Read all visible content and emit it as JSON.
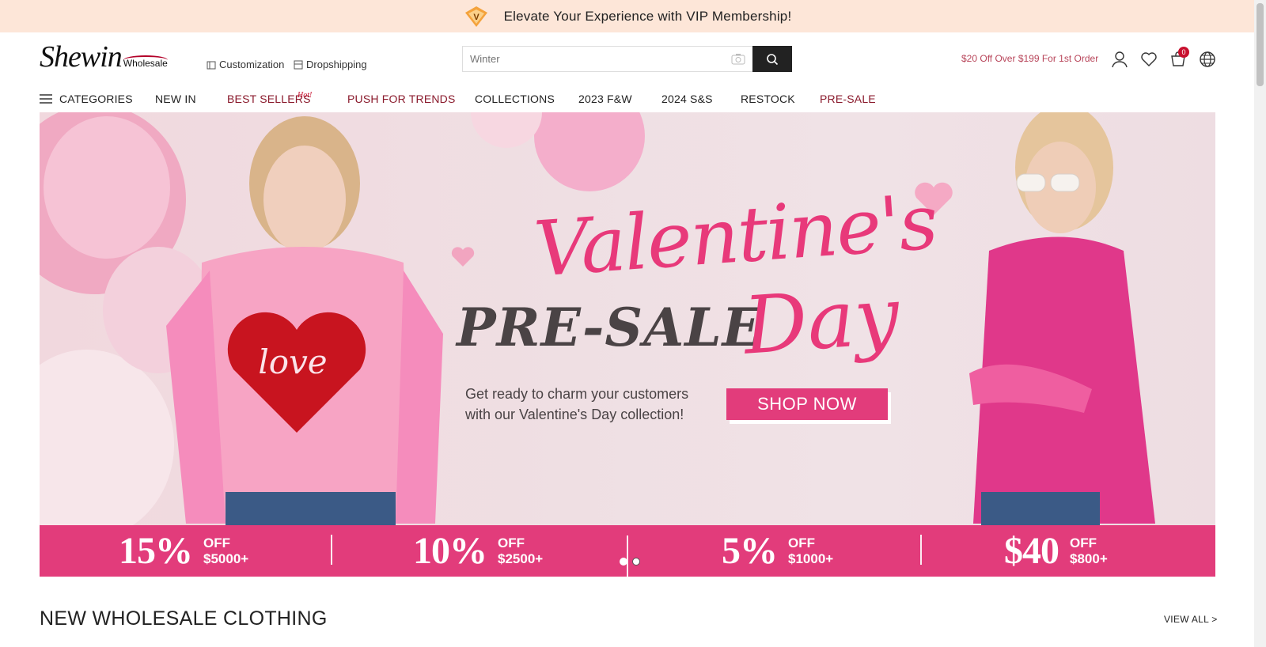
{
  "promo_bar": {
    "text": "Elevate Your Experience with VIP Membership!",
    "icon": "vip-diamond-icon"
  },
  "header": {
    "logo_main": "Shewin",
    "logo_sub": "Wholesale",
    "links": [
      {
        "label": "Customization",
        "icon": "customization-icon"
      },
      {
        "label": "Dropshipping",
        "icon": "dropshipping-icon"
      }
    ],
    "search": {
      "placeholder": "Winter"
    },
    "offer": "$20 Off Over $199 For 1st Order",
    "cart_count": "0"
  },
  "nav": {
    "categories_label": "CATEGORIES",
    "items": [
      {
        "label": "NEW IN"
      },
      {
        "label": "BEST SELLERS",
        "tag": "Hot!"
      },
      {
        "label": "PUSH FOR TRENDS"
      },
      {
        "label": "COLLECTIONS"
      },
      {
        "label": "2023 F&W"
      },
      {
        "label": "2024 S&S"
      },
      {
        "label": "RESTOCK"
      },
      {
        "label": "PRE-SALE"
      }
    ]
  },
  "banner": {
    "script_line1": "Valentine's",
    "script_line2": "Day",
    "main_line": "PRE-SALE",
    "subtext_line1": "Get ready to charm your customers",
    "subtext_line2": "with our Valentine's Day collection!",
    "cta": "SHOP NOW",
    "deals": [
      {
        "pct": "15%",
        "off": "OFF",
        "min": "$5000+"
      },
      {
        "pct": "10%",
        "off": "OFF",
        "min": "$2500+"
      },
      {
        "pct": "5%",
        "off": "OFF",
        "min": "$1000+"
      },
      {
        "pct": "$40",
        "off": "OFF",
        "min": "$800+"
      }
    ],
    "slide_count": 2,
    "active_slide": 1
  },
  "section": {
    "title": "NEW WHOLESALE CLOTHING",
    "view_all": "VIEW ALL >"
  },
  "colors": {
    "accent": "#e23c7b",
    "promo_bg": "#fde6d8",
    "nav_red": "#8a1a2c"
  }
}
